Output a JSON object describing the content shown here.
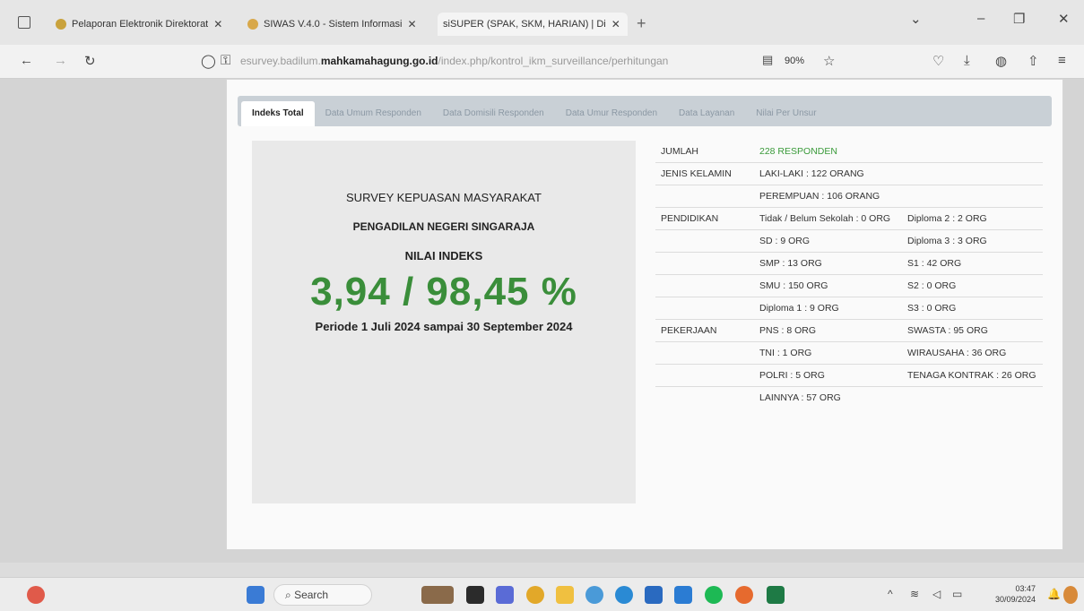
{
  "browser": {
    "tabs": [
      {
        "title": "Pelaporan Elektronik Direktorat",
        "close": "✕"
      },
      {
        "title": "SIWAS V.4.0 - Sistem Informasi",
        "close": "✕"
      },
      {
        "title": "siSUPER (SPAK, SKM, HARIAN) | Di",
        "close": "✕"
      }
    ],
    "url_pre": "esurvey.badilum.",
    "url_domain": "mahkamahagung.go.id",
    "url_post": "/index.php/kontrol_ikm_surveillance/perhitungan",
    "zoom": "90%"
  },
  "page_tabs": [
    "Indeks Total",
    "Data Umum Responden",
    "Data Domisili Responden",
    "Data Umur Responden",
    "Data Layanan",
    "Nilai Per Unsur"
  ],
  "summary": {
    "survey": "SURVEY KEPUASAN MASYARAKAT",
    "court": "PENGADILAN NEGERI SINGARAJA",
    "nilai": "NILAI INDEKS",
    "score": "3,94 / 98,45 %",
    "period": "Periode 1 Juli 2024 sampai 30 September 2024"
  },
  "stats": {
    "jumlah": {
      "label": "JUMLAH",
      "value": "228 RESPONDEN"
    },
    "jenis": {
      "label": "JENIS KELAMIN",
      "laki": "LAKI-LAKI : 122 ORANG",
      "perempuan": "PEREMPUAN : 106 ORANG"
    },
    "pendidikan": {
      "label": "PENDIDIKAN",
      "rows": [
        [
          "Tidak / Belum Sekolah : 0 ORG",
          "Diploma 2 : 2 ORG"
        ],
        [
          "SD : 9 ORG",
          "Diploma 3 : 3 ORG"
        ],
        [
          "SMP : 13 ORG",
          "S1 : 42 ORG"
        ],
        [
          "SMU : 150 ORG",
          "S2 : 0 ORG"
        ],
        [
          "Diploma 1 : 9 ORG",
          "S3 : 0 ORG"
        ]
      ]
    },
    "pekerjaan": {
      "label": "PEKERJAAN",
      "rows": [
        [
          "PNS : 8 ORG",
          "SWASTA : 95 ORG"
        ],
        [
          "TNI : 1 ORG",
          "WIRAUSAHA : 36 ORG"
        ],
        [
          "POLRI : 5 ORG",
          "TENAGA KONTRAK : 26 ORG"
        ],
        [
          "LAINNYA : 57 ORG",
          ""
        ]
      ]
    }
  },
  "taskbar": {
    "search": "Search",
    "time": "03:47",
    "date": "30/09/2024"
  },
  "colors": {
    "score_green": "#3a8e3a",
    "responden_green": "#3a9a3a"
  }
}
